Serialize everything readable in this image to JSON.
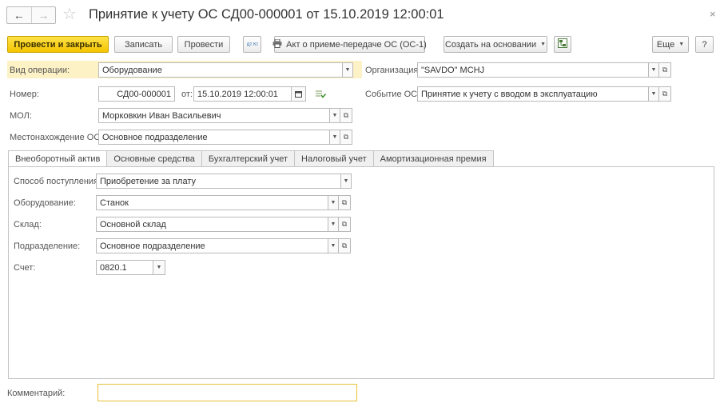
{
  "window": {
    "title": "Принятие к учету ОС СД00-000001 от 15.10.2019 12:00:01",
    "close_glyph": "×"
  },
  "nav": {
    "back_glyph": "←",
    "forward_glyph": "→",
    "star_glyph": "☆"
  },
  "toolbar": {
    "post_close_label": "Провести и закрыть",
    "save_label": "Записать",
    "post_label": "Провести",
    "dt_kt_label": "Дт Кт",
    "print_label": "Акт о приеме-передаче ОС (ОС-1)",
    "create_based_label": "Создать на основании",
    "more_label": "Еще",
    "help_label": "?"
  },
  "header": {
    "operation_label": "Вид операции:",
    "operation_value": "Оборудование",
    "org_label": "Организация:",
    "org_value": "\"SAVDO\" MCHJ",
    "number_label": "Номер:",
    "number_value": "СД00-000001",
    "date_from_label": "от:",
    "date_value": "15.10.2019 12:00:01",
    "event_label": "Событие ОС:",
    "event_value": "Принятие к учету с вводом в эксплуатацию",
    "mol_label": "МОЛ:",
    "mol_value": "Морковкин Иван Васильевич",
    "location_label": "Местонахождение ОС:",
    "location_value": "Основное подразделение"
  },
  "tabs": [
    {
      "label": "Внеоборотный актив",
      "active": true
    },
    {
      "label": "Основные средства",
      "active": false
    },
    {
      "label": "Бухгалтерский учет",
      "active": false
    },
    {
      "label": "Налоговый учет",
      "active": false
    },
    {
      "label": "Амортизационная премия",
      "active": false
    }
  ],
  "asset_tab": {
    "receipt_label": "Способ поступления:",
    "receipt_value": "Приобретение за плату",
    "equipment_label": "Оборудование:",
    "equipment_value": "Станок",
    "warehouse_label": "Склад:",
    "warehouse_value": "Основной склад",
    "division_label": "Подразделение:",
    "division_value": "Основное подразделение",
    "account_label": "Счет:",
    "account_value": "0820.1"
  },
  "footer": {
    "comment_label": "Комментарий:",
    "comment_value": ""
  },
  "colors": {
    "primary_button": "#f5c400",
    "operation_highlight": "#fdf1c6",
    "comment_border": "#e8c13a"
  }
}
